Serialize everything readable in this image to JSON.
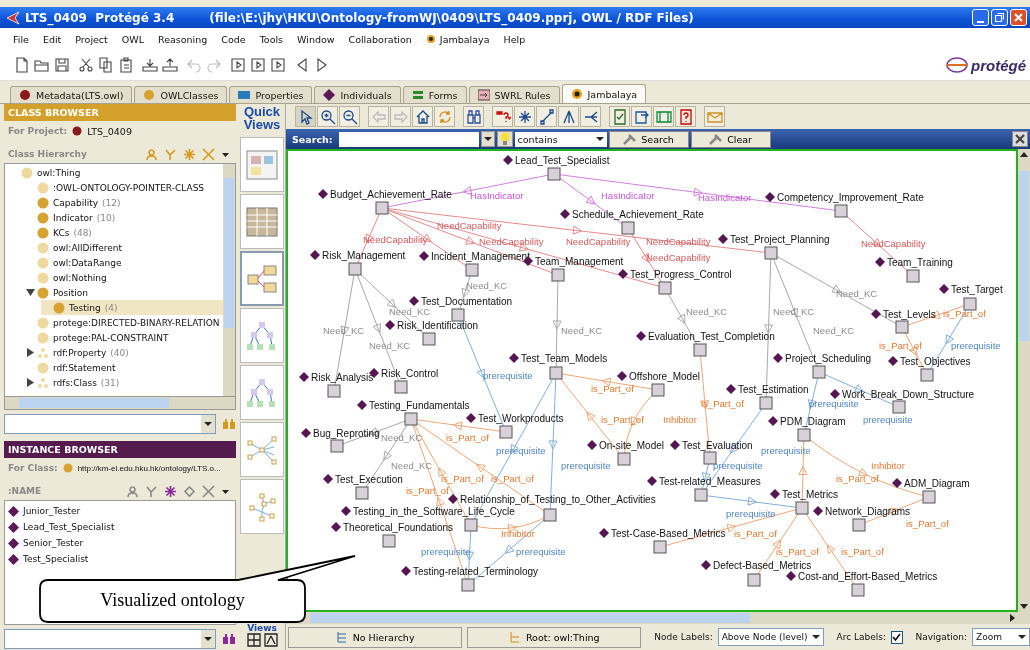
{
  "window": {
    "title": "LTS_0409  Protégé 3.4",
    "file": "(file:\\E:\\jhy\\HKU\\Ontology-fromWJ\\0409\\LTS_0409.pprj, OWL / RDF Files)"
  },
  "menu": [
    {
      "label": "File",
      "kind": "plain"
    },
    {
      "label": "Edit",
      "kind": "plain"
    },
    {
      "label": "Project",
      "kind": "plain"
    },
    {
      "label": "OWL",
      "kind": "plain"
    },
    {
      "label": "Reasoning",
      "kind": "plain"
    },
    {
      "label": "Code",
      "kind": "plain"
    },
    {
      "label": "Tools",
      "kind": "plain"
    },
    {
      "label": "Window",
      "kind": "plain"
    },
    {
      "label": "Collaboration",
      "kind": "plain"
    },
    {
      "label": "Jambalaya",
      "kind": "plugin"
    },
    {
      "label": "Help",
      "kind": "plain"
    }
  ],
  "logo": {
    "text": "protégé"
  },
  "tabs": [
    {
      "label": "Metadata(LTS.owl)",
      "kind": "metadata",
      "selected": false
    },
    {
      "label": "OWLClasses",
      "kind": "classes",
      "selected": false
    },
    {
      "label": "Properties",
      "kind": "properties",
      "selected": false
    },
    {
      "label": "Individuals",
      "kind": "individuals",
      "selected": false
    },
    {
      "label": "Forms",
      "kind": "forms",
      "selected": false
    },
    {
      "label": "SWRL Rules",
      "kind": "rules",
      "selected": false
    },
    {
      "label": "Jambalaya",
      "kind": "jambalaya",
      "selected": true
    }
  ],
  "class_browser": {
    "title": "CLASS BROWSER",
    "project_label": "For Project:",
    "project": "LTS_0409",
    "hierarchy_title": "Class Hierarchy",
    "tree": [
      {
        "label": "owl:Thing",
        "kind": "system",
        "selected": false,
        "children": [
          {
            "label": ":OWL-ONTOLOGY-POINTER-CLASS",
            "kind": "system",
            "selected": false
          },
          {
            "label": "Capability",
            "count": "(12)",
            "kind": "user",
            "selected": false
          },
          {
            "label": "Indicator",
            "count": "(10)",
            "kind": "user",
            "selected": false
          },
          {
            "label": "KCs",
            "count": "(48)",
            "kind": "user",
            "selected": false
          },
          {
            "label": "owl:AllDifferent",
            "kind": "system",
            "selected": false
          },
          {
            "label": "owl:DataRange",
            "kind": "system",
            "selected": false
          },
          {
            "label": "owl:Nothing",
            "kind": "system",
            "selected": false
          },
          {
            "label": "Position",
            "kind": "user",
            "selected": false,
            "expanded": true,
            "children": [
              {
                "label": "Testing",
                "count": "(4)",
                "kind": "user",
                "selected": true
              }
            ]
          },
          {
            "label": "protege:DIRECTED-BINARY-RELATION",
            "kind": "system",
            "selected": false
          },
          {
            "label": "protege:PAL-CONSTRAINT",
            "kind": "system",
            "selected": false
          },
          {
            "label": "rdf:Property",
            "count": "(40)",
            "kind": "property",
            "selected": false,
            "expanded": false
          },
          {
            "label": "rdf:Statement",
            "kind": "system",
            "selected": false
          },
          {
            "label": "rdfs:Class",
            "count": "(31)",
            "kind": "property",
            "selected": false,
            "expanded": false
          }
        ]
      }
    ]
  },
  "instance_browser": {
    "title": "INSTANCE BROWSER",
    "class_label": "For Class:",
    "class": "http://km-el.edu.hku.hk/ontology/LTS.o...",
    "column": ":NAME",
    "instances": [
      {
        "label": "Junior_Tester",
        "selected": false
      },
      {
        "label": "Lead_Test_Specialist",
        "selected": false
      },
      {
        "label": "Senior_Tester",
        "selected": false
      },
      {
        "label": "Test_Specialist",
        "selected": false
      }
    ]
  },
  "quick_views": {
    "title": "Quick Views",
    "footer": "Views",
    "items": [
      {
        "kind": "forms",
        "selected": false
      },
      {
        "kind": "table",
        "selected": false
      },
      {
        "kind": "nested",
        "selected": true
      },
      {
        "kind": "tree",
        "selected": false
      },
      {
        "kind": "tree",
        "selected": false
      },
      {
        "kind": "radial",
        "selected": false
      },
      {
        "kind": "spring",
        "selected": false
      }
    ]
  },
  "search": {
    "label": "Search:",
    "mode": "contains",
    "search_button": "Search",
    "clear_button": "Clear"
  },
  "graph": {
    "nodes": [
      {
        "label": "Lead_Test_Specialist"
      },
      {
        "label": "Budget_Achievement_Rate"
      },
      {
        "label": "Competency_Improvement_Rate"
      },
      {
        "label": "Schedule_Achievement_Rate"
      },
      {
        "label": "Test_Project_Planning"
      },
      {
        "label": "Risk_Management"
      },
      {
        "label": "Incident_Management"
      },
      {
        "label": "Team_Management"
      },
      {
        "label": "Team_Training"
      },
      {
        "label": "Test_Progress_Control"
      },
      {
        "label": "Test_Target"
      },
      {
        "label": "Test_Documentation"
      },
      {
        "label": "Test_Levels"
      },
      {
        "label": "Risk_Identification"
      },
      {
        "label": "Evaluation_Test_Completion"
      },
      {
        "label": "Test_Team_Models"
      },
      {
        "label": "Project_Scheduling"
      },
      {
        "label": "Test_Objectives"
      },
      {
        "label": "Risk_Analysis"
      },
      {
        "label": "Risk_Control"
      },
      {
        "label": "Offshore_Model"
      },
      {
        "label": "Test_Estimation"
      },
      {
        "label": "Work_Break_Down_Structure"
      },
      {
        "label": "Testing_Fundamentals"
      },
      {
        "label": "Test_Workproducts"
      },
      {
        "label": "PDM_Diagram"
      },
      {
        "label": "Bug_Reproting"
      },
      {
        "label": "On-site_Model"
      },
      {
        "label": "Test_Evaluation"
      },
      {
        "label": "Test_Execution"
      },
      {
        "label": "Test-related_Measures"
      },
      {
        "label": "ADM_Diagram"
      },
      {
        "label": "Relationship_of_Testing_to_Other_Activities"
      },
      {
        "label": "Test_Metrics"
      },
      {
        "label": "Testing_in_the_Software_Life_Cycle"
      },
      {
        "label": "Network_Diagrams"
      },
      {
        "label": "Theoretical_Foundations"
      },
      {
        "label": "Test-Case-Based_Metrics"
      },
      {
        "label": "Testing-related_Terminology"
      },
      {
        "label": "Defect-Based_Metrics"
      },
      {
        "label": "Cost-and_Effort-Based_Metrics"
      }
    ],
    "arcs": [
      {
        "label": "HasIndicator",
        "kind": "indicator"
      },
      {
        "label": "HasIndicator",
        "kind": "indicator"
      },
      {
        "label": "HasIndicator",
        "kind": "indicator"
      },
      {
        "label": "NeedCapability",
        "kind": "capability"
      },
      {
        "label": "NeedCapability",
        "kind": "capability"
      },
      {
        "label": "NeedCapability",
        "kind": "capability"
      },
      {
        "label": "NeedCapability",
        "kind": "capability"
      },
      {
        "label": "NeedCapability",
        "kind": "capability"
      },
      {
        "label": "NeedCapability",
        "kind": "capability"
      },
      {
        "label": "NeedCapability",
        "kind": "capability"
      },
      {
        "label": "Need_KC",
        "kind": "knowledge"
      },
      {
        "label": "Need_KC",
        "kind": "knowledge"
      },
      {
        "label": "Need_KC",
        "kind": "knowledge"
      },
      {
        "label": "Need_KC",
        "kind": "knowledge"
      },
      {
        "label": "Need_KC",
        "kind": "knowledge"
      },
      {
        "label": "is_Part_of",
        "kind": "part"
      },
      {
        "label": "Need_KC",
        "kind": "knowledge"
      },
      {
        "label": "Need_KC",
        "kind": "knowledge"
      },
      {
        "label": "Need_KC",
        "kind": "knowledge"
      },
      {
        "label": "Need_KC",
        "kind": "knowledge"
      },
      {
        "label": "is_Part_of",
        "kind": "part"
      },
      {
        "label": "prerequisite",
        "kind": "prerequisite"
      },
      {
        "label": "prerequisite",
        "kind": "prerequisite"
      },
      {
        "label": "is_Part_of",
        "kind": "part"
      },
      {
        "label": "is_Part_of",
        "kind": "part"
      },
      {
        "label": "prerequisite",
        "kind": "prerequisite"
      },
      {
        "label": "is_Part_of",
        "kind": "part"
      },
      {
        "label": "Inhibitor",
        "kind": "inhibitor"
      },
      {
        "label": "prerequisite",
        "kind": "prerequisite"
      },
      {
        "label": "Need_KC",
        "kind": "knowledge"
      },
      {
        "label": "is_Part_of",
        "kind": "part"
      },
      {
        "label": "prerequisite",
        "kind": "prerequisite"
      },
      {
        "label": "prerequisite",
        "kind": "prerequisite"
      },
      {
        "label": "Need_KC",
        "kind": "knowledge"
      },
      {
        "label": "prerequisite",
        "kind": "prerequisite"
      },
      {
        "label": "prerequisite",
        "kind": "prerequisite"
      },
      {
        "label": "Inhibitor",
        "kind": "inhibitor"
      },
      {
        "label": "is_Part_of",
        "kind": "part"
      },
      {
        "label": "is_Part_of",
        "kind": "part"
      },
      {
        "label": "is_Part_of",
        "kind": "part"
      },
      {
        "label": "is_Part_of",
        "kind": "part"
      },
      {
        "label": "prerequisite",
        "kind": "prerequisite"
      },
      {
        "label": "is_Part_of",
        "kind": "part"
      },
      {
        "label": "Inhibitor",
        "kind": "inhibitor"
      },
      {
        "label": "is_Part_of",
        "kind": "part"
      },
      {
        "label": "prerequisite",
        "kind": "prerequisite"
      },
      {
        "label": "prerequisite",
        "kind": "prerequisite"
      },
      {
        "label": "is_Part_of",
        "kind": "part"
      },
      {
        "label": "is_Part_of",
        "kind": "part"
      }
    ]
  },
  "bottom_bar": {
    "hierarchy_button": "No Hierarchy",
    "root_button": "Root: owl:Thing",
    "node_labels_label": "Node Labels:",
    "node_labels": "Above Node (level)",
    "arc_labels_label": "Arc Labels:",
    "arc_labels": true,
    "navigation_label": "Navigation:",
    "navigation": "Zoom"
  },
  "callout": {
    "text": "Visualized ontology"
  }
}
